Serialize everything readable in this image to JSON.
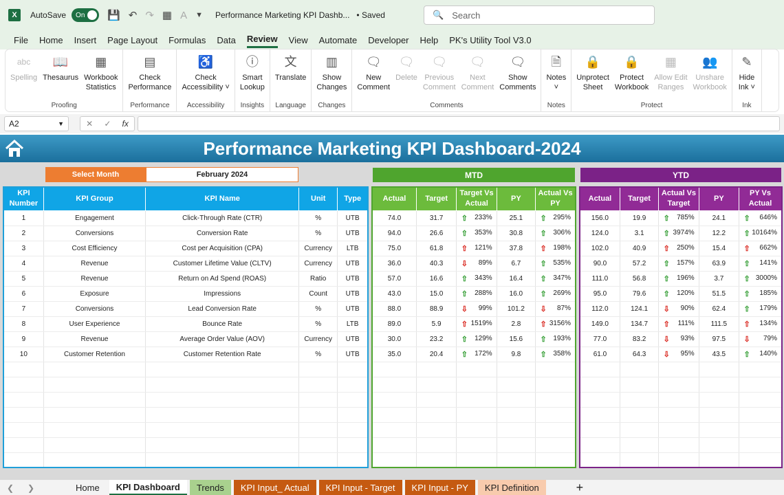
{
  "titlebar": {
    "autosave_label": "AutoSave",
    "toggle_label": "On",
    "doc_title": "Performance Marketing KPI Dashb...",
    "saved_label": "• Saved",
    "search_placeholder": "Search"
  },
  "menu": [
    "File",
    "Home",
    "Insert",
    "Page Layout",
    "Formulas",
    "Data",
    "Review",
    "View",
    "Automate",
    "Developer",
    "Help",
    "PK's Utility Tool V3.0"
  ],
  "menu_active": "Review",
  "ribbon": {
    "groups": [
      {
        "label": "Proofing",
        "buttons": [
          {
            "label": "Spelling",
            "icon": "spelling-icon",
            "disabled": true
          },
          {
            "label": "Thesaurus",
            "icon": "thesaurus-icon",
            "disabled": false
          },
          {
            "label": "Workbook\nStatistics",
            "icon": "workbook-statistics-icon",
            "disabled": false
          }
        ]
      },
      {
        "label": "Performance",
        "buttons": [
          {
            "label": "Check\nPerformance",
            "icon": "check-performance-icon",
            "disabled": false
          }
        ]
      },
      {
        "label": "Accessibility",
        "buttons": [
          {
            "label": "Check\nAccessibility ˅",
            "icon": "check-accessibility-icon",
            "disabled": false
          }
        ]
      },
      {
        "label": "Insights",
        "buttons": [
          {
            "label": "Smart\nLookup",
            "icon": "smart-lookup-icon",
            "disabled": false
          }
        ]
      },
      {
        "label": "Language",
        "buttons": [
          {
            "label": "Translate",
            "icon": "translate-icon",
            "disabled": false
          }
        ]
      },
      {
        "label": "Changes",
        "buttons": [
          {
            "label": "Show\nChanges",
            "icon": "show-changes-icon",
            "disabled": false
          }
        ]
      },
      {
        "label": "Comments",
        "buttons": [
          {
            "label": "New\nComment",
            "icon": "new-comment-icon",
            "disabled": false
          },
          {
            "label": "Delete",
            "icon": "delete-comment-icon",
            "disabled": true
          },
          {
            "label": "Previous\nComment",
            "icon": "previous-comment-icon",
            "disabled": true
          },
          {
            "label": "Next\nComment",
            "icon": "next-comment-icon",
            "disabled": true
          },
          {
            "label": "Show\nComments",
            "icon": "show-comments-icon",
            "disabled": false
          }
        ]
      },
      {
        "label": "Notes",
        "buttons": [
          {
            "label": "Notes\n˅",
            "icon": "notes-icon",
            "disabled": false
          }
        ]
      },
      {
        "label": "Protect",
        "buttons": [
          {
            "label": "Unprotect\nSheet",
            "icon": "unprotect-sheet-icon",
            "disabled": false
          },
          {
            "label": "Protect\nWorkbook",
            "icon": "protect-workbook-icon",
            "disabled": false
          },
          {
            "label": "Allow Edit\nRanges",
            "icon": "allow-edit-ranges-icon",
            "disabled": true
          },
          {
            "label": "Unshare\nWorkbook",
            "icon": "unshare-workbook-icon",
            "disabled": true
          }
        ]
      },
      {
        "label": "Ink",
        "buttons": [
          {
            "label": "Hide\nInk ˅",
            "icon": "hide-ink-icon",
            "disabled": false
          }
        ]
      }
    ]
  },
  "formula_bar": {
    "name_box": "A2",
    "fx": "fx"
  },
  "dashboard": {
    "title": "Performance Marketing KPI Dashboard-2024",
    "select_month_label": "Select Month",
    "select_month_value": "February 2024",
    "mtd_label": "MTD",
    "ytd_label": "YTD",
    "kpi_headers": [
      "KPI\nNumber",
      "KPI Group",
      "KPI Name",
      "Unit",
      "Type"
    ],
    "mtd_headers": [
      "Actual",
      "Target",
      "Target Vs\nActual",
      "PY",
      "Actual Vs\nPY"
    ],
    "ytd_headers": [
      "Actual",
      "Target",
      "Actual Vs\nTarget",
      "PY",
      "PY Vs\nActual"
    ],
    "rows": [
      {
        "num": "1",
        "group": "Engagement",
        "name": "Click-Through Rate (CTR)",
        "unit": "%",
        "type": "UTB",
        "mtd": {
          "actual": "74.0",
          "target": "31.7",
          "tva": "233%",
          "tva_dir": "up",
          "py": "25.1",
          "avp": "295%",
          "avp_dir": "up"
        },
        "ytd": {
          "actual": "156.0",
          "target": "19.9",
          "avt": "785%",
          "avt_dir": "up",
          "py": "24.1",
          "pva": "646%",
          "pva_dir": "up"
        }
      },
      {
        "num": "2",
        "group": "Conversions",
        "name": "Conversion Rate",
        "unit": "%",
        "type": "UTB",
        "mtd": {
          "actual": "94.0",
          "target": "26.6",
          "tva": "353%",
          "tva_dir": "up",
          "py": "30.8",
          "avp": "306%",
          "avp_dir": "up"
        },
        "ytd": {
          "actual": "124.0",
          "target": "3.1",
          "avt": "3974%",
          "avt_dir": "up",
          "py": "12.2",
          "pva": "10164%",
          "pva_dir": "up"
        }
      },
      {
        "num": "3",
        "group": "Cost Efficiency",
        "name": "Cost per Acquisition (CPA)",
        "unit": "Currency",
        "type": "LTB",
        "mtd": {
          "actual": "75.0",
          "target": "61.8",
          "tva": "121%",
          "tva_dir": "dn",
          "py": "37.8",
          "avp": "198%",
          "avp_dir": "dn"
        },
        "ytd": {
          "actual": "102.0",
          "target": "40.9",
          "avt": "250%",
          "avt_dir": "dn",
          "py": "15.4",
          "pva": "662%",
          "pva_dir": "dn"
        }
      },
      {
        "num": "4",
        "group": "Revenue",
        "name": "Customer Lifetime Value (CLTV)",
        "unit": "Currency",
        "type": "UTB",
        "mtd": {
          "actual": "36.0",
          "target": "40.3",
          "tva": "89%",
          "tva_dir": "dn2",
          "py": "6.7",
          "avp": "535%",
          "avp_dir": "up"
        },
        "ytd": {
          "actual": "90.0",
          "target": "57.2",
          "avt": "157%",
          "avt_dir": "up",
          "py": "63.9",
          "pva": "141%",
          "pva_dir": "up"
        }
      },
      {
        "num": "5",
        "group": "Revenue",
        "name": "Return on Ad Spend (ROAS)",
        "unit": "Ratio",
        "type": "UTB",
        "mtd": {
          "actual": "57.0",
          "target": "16.6",
          "tva": "343%",
          "tva_dir": "up",
          "py": "16.4",
          "avp": "347%",
          "avp_dir": "up"
        },
        "ytd": {
          "actual": "111.0",
          "target": "56.8",
          "avt": "196%",
          "avt_dir": "up",
          "py": "3.7",
          "pva": "3000%",
          "pva_dir": "up"
        }
      },
      {
        "num": "6",
        "group": "Exposure",
        "name": "Impressions",
        "unit": "Count",
        "type": "UTB",
        "mtd": {
          "actual": "43.0",
          "target": "15.0",
          "tva": "288%",
          "tva_dir": "up",
          "py": "16.0",
          "avp": "269%",
          "avp_dir": "up"
        },
        "ytd": {
          "actual": "95.0",
          "target": "79.6",
          "avt": "120%",
          "avt_dir": "up",
          "py": "51.5",
          "pva": "185%",
          "pva_dir": "up"
        }
      },
      {
        "num": "7",
        "group": "Conversions",
        "name": "Lead Conversion Rate",
        "unit": "%",
        "type": "UTB",
        "mtd": {
          "actual": "88.0",
          "target": "88.9",
          "tva": "99%",
          "tva_dir": "dn2",
          "py": "101.2",
          "avp": "87%",
          "avp_dir": "dn2"
        },
        "ytd": {
          "actual": "112.0",
          "target": "124.1",
          "avt": "90%",
          "avt_dir": "dn2",
          "py": "62.4",
          "pva": "179%",
          "pva_dir": "up"
        }
      },
      {
        "num": "8",
        "group": "User Experience",
        "name": "Bounce Rate",
        "unit": "%",
        "type": "LTB",
        "mtd": {
          "actual": "89.0",
          "target": "5.9",
          "tva": "1519%",
          "tva_dir": "dn",
          "py": "2.8",
          "avp": "3156%",
          "avp_dir": "dn"
        },
        "ytd": {
          "actual": "149.0",
          "target": "134.7",
          "avt": "111%",
          "avt_dir": "dn",
          "py": "111.5",
          "pva": "134%",
          "pva_dir": "dn"
        }
      },
      {
        "num": "9",
        "group": "Revenue",
        "name": "Average Order Value (AOV)",
        "unit": "Currency",
        "type": "UTB",
        "mtd": {
          "actual": "30.0",
          "target": "23.2",
          "tva": "129%",
          "tva_dir": "up",
          "py": "15.6",
          "avp": "193%",
          "avp_dir": "up"
        },
        "ytd": {
          "actual": "77.0",
          "target": "83.2",
          "avt": "93%",
          "avt_dir": "dn2",
          "py": "97.5",
          "pva": "79%",
          "pva_dir": "dn2"
        }
      },
      {
        "num": "10",
        "group": "Customer Retention",
        "name": "Customer Retention Rate",
        "unit": "%",
        "type": "UTB",
        "mtd": {
          "actual": "35.0",
          "target": "20.4",
          "tva": "172%",
          "tva_dir": "up",
          "py": "9.8",
          "avp": "358%",
          "avp_dir": "up"
        },
        "ytd": {
          "actual": "61.0",
          "target": "64.3",
          "avt": "95%",
          "avt_dir": "dn2",
          "py": "43.5",
          "pva": "140%",
          "pva_dir": "up"
        }
      }
    ],
    "empty_rows": 7
  },
  "sheet_tabs": [
    {
      "label": "Home",
      "style": "home"
    },
    {
      "label": "KPI Dashboard",
      "style": "active"
    },
    {
      "label": "Trends",
      "style": "trends"
    },
    {
      "label": "KPI Input_ Actual",
      "style": "orange"
    },
    {
      "label": "KPI Input - Target",
      "style": "orange"
    },
    {
      "label": "KPI Input - PY",
      "style": "orange"
    },
    {
      "label": "KPI Definition",
      "style": "pink"
    }
  ],
  "colors": {
    "excel_green": "#1d6f42",
    "mtd_green": "#4fa52e",
    "ytd_purple": "#7b2287",
    "kpi_blue": "#10a5e6",
    "select_orange": "#ed7d31"
  }
}
